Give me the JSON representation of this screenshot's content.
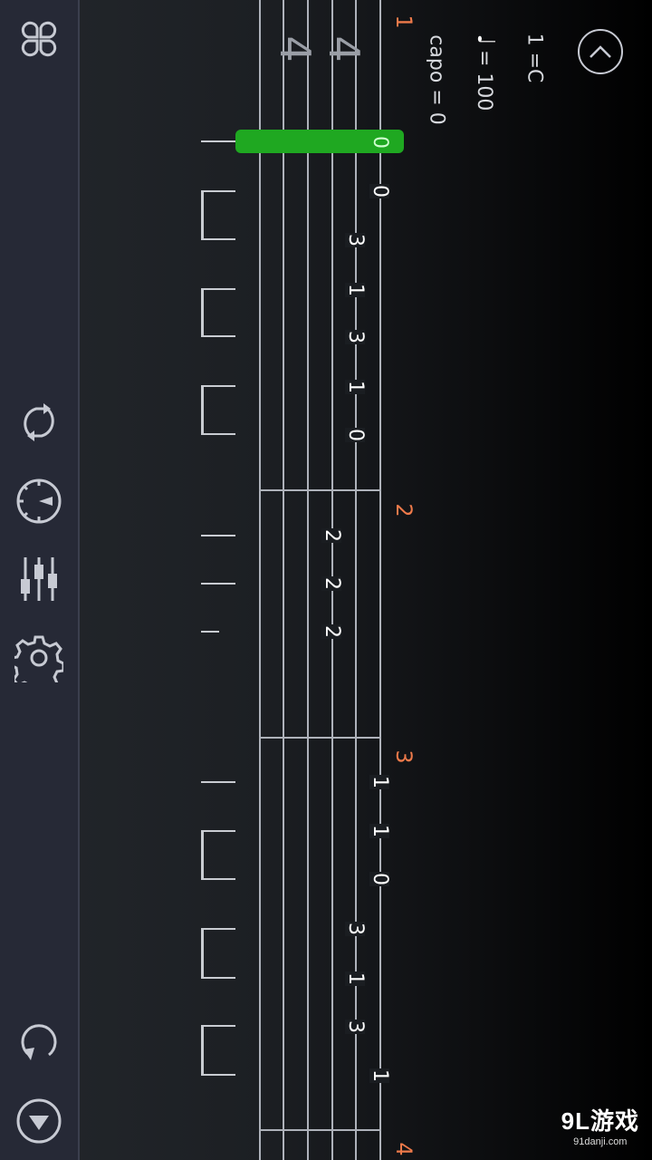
{
  "header": {
    "key": "1 =C",
    "tempo": "= 100",
    "capo": "capo = 0"
  },
  "sidebar": {
    "grid_icon": "grid-icon",
    "loop_icon": "loop-icon",
    "metronome_icon": "metronome-icon",
    "mixer_icon": "mixer-icon",
    "settings_icon": "gear-icon",
    "refresh_icon": "refresh-icon",
    "down_icon": "down-arrow-icon"
  },
  "time_signature": {
    "top": "4",
    "bottom": "4"
  },
  "measures": [
    {
      "number": "1"
    },
    {
      "number": "2"
    },
    {
      "number": "3"
    },
    {
      "number": "4"
    }
  ],
  "notes": [
    {
      "fret": "0",
      "highlighted": true
    },
    {
      "fret": "0"
    },
    {
      "fret": "3"
    },
    {
      "fret": "1"
    },
    {
      "fret": "3"
    },
    {
      "fret": "1"
    },
    {
      "fret": "0"
    },
    {
      "fret": "2"
    },
    {
      "fret": "2"
    },
    {
      "fret": "2"
    },
    {
      "fret": "1"
    },
    {
      "fret": "1"
    },
    {
      "fret": "0"
    },
    {
      "fret": "3"
    },
    {
      "fret": "1"
    },
    {
      "fret": "3"
    },
    {
      "fret": "1"
    }
  ],
  "watermark": {
    "brand": "9L游戏",
    "site": "91danji.com"
  },
  "colors": {
    "accent_measure": "#ee7a4a",
    "cursor": "#1fa821",
    "sidebar_bg": "#262936",
    "staff_line": "#aeb2ba"
  }
}
